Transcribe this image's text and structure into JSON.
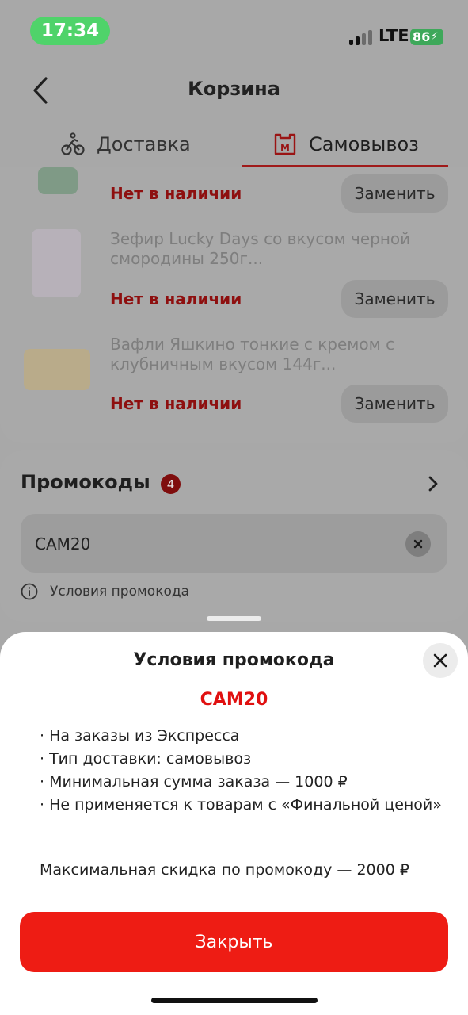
{
  "status_bar": {
    "time": "17:34",
    "network": "LTE",
    "battery": "86"
  },
  "header": {
    "title": "Корзина"
  },
  "tabs": [
    {
      "label": "Доставка",
      "icon": "courier-bicycle-icon",
      "active": false
    },
    {
      "label": "Самовывоз",
      "icon": "store-m-icon",
      "active": true
    }
  ],
  "products": [
    {
      "name": "",
      "stock_status": "Нет в наличии",
      "action": "Заменить"
    },
    {
      "name": "Зефир Lucky Days со вкусом черной смородины 250г...",
      "stock_status": "Нет в наличии",
      "action": "Заменить"
    },
    {
      "name": "Вафли Яшкино тонкие с кремом с клубничным вкусом 144г...",
      "stock_status": "Нет в наличии",
      "action": "Заменить"
    }
  ],
  "promo": {
    "title": "Промокоды",
    "count": "4",
    "value": "САМ20",
    "conditions_link": "Условия промокода"
  },
  "sheet": {
    "title": "Условия промокода",
    "code": "САМ20",
    "conditions": [
      "· На заказы из Экспресса",
      "· Тип доставки: самовывоз",
      "· Минимальная сумма заказа — 1000 ₽",
      "· Не применяется к товарам с «Финальной ценой»"
    ],
    "max_discount": "Максимальная скидка по промокоду — 2000 ₽",
    "close_label": "Закрыть"
  },
  "colors": {
    "accent_red": "#ee1c14",
    "promo_code_red": "#e01010",
    "status_time_green": "#4fd36a"
  }
}
